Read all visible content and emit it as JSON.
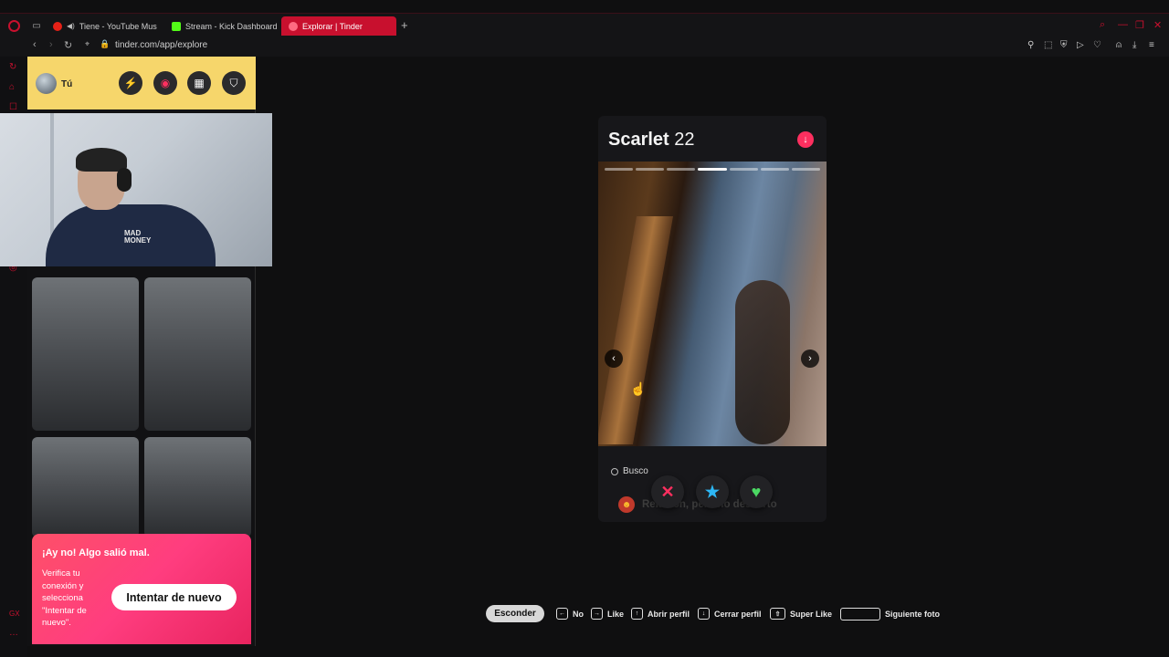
{
  "browser": {
    "tabs": [
      {
        "label": "Tiene - YouTube Music",
        "icon": "youtube-music-icon"
      },
      {
        "label": "Stream - Kick Dashboard",
        "icon": "kick-icon"
      },
      {
        "label": "Explorar | Tinder",
        "icon": "tinder-flame-icon"
      }
    ],
    "url": "tinder.com/app/explore"
  },
  "user": {
    "name": "Tú"
  },
  "webcam": {
    "hoodie_text": "MAD MONEY"
  },
  "error": {
    "title": "¡Ay no! Algo salió mal.",
    "message": "Verifica tu conexión y selecciona \"Intentar de nuevo\".",
    "retry_label": "Intentar de nuevo"
  },
  "profile": {
    "name": "Scarlet",
    "age": "22",
    "photo_count": 7,
    "current_photo": 4,
    "looking_for_label": "Busco",
    "looking_for_value": "Relación, pero no descarto"
  },
  "shortcuts": {
    "hide_label": "Esconder",
    "items": [
      {
        "key": "←",
        "label": "No"
      },
      {
        "key": "→",
        "label": "Like"
      },
      {
        "key": "↑",
        "label": "Abrir perfil"
      },
      {
        "key": "↓",
        "label": "Cerrar perfil"
      },
      {
        "key": "⇧",
        "label": "Super Like"
      },
      {
        "key": "",
        "label": "Siguiente foto"
      }
    ]
  },
  "colors": {
    "tinder_pink": "#fd2f5f",
    "browser_red": "#c8102e",
    "userbar_yellow": "#f6d66b"
  }
}
